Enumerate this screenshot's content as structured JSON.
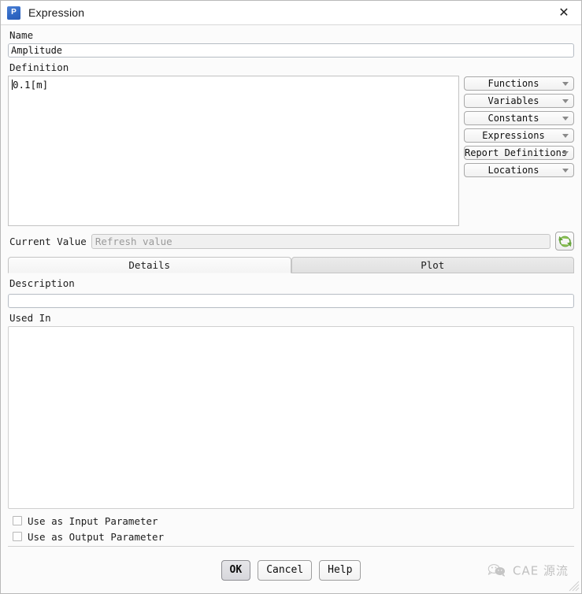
{
  "window": {
    "title": "Expression",
    "app_icon": "workbench-parameter-icon",
    "app_icon_glyph": "P",
    "close_label": "✕"
  },
  "form": {
    "name_label": "Name",
    "name_value": "Amplitude",
    "name_placeholder": "",
    "definition_label": "Definition",
    "definition_value": "0.1[m]",
    "current_value_label": "Current Value",
    "current_value_text": "",
    "current_value_placeholder": "Refresh value",
    "refresh_icon": "refresh-icon",
    "description_label": "Description",
    "description_value": "",
    "description_placeholder": "",
    "used_in_label": "Used In",
    "used_in_items": []
  },
  "dropdowns": [
    {
      "label": "Functions",
      "name": "functions"
    },
    {
      "label": "Variables",
      "name": "variables"
    },
    {
      "label": "Constants",
      "name": "constants"
    },
    {
      "label": "Expressions",
      "name": "expressions"
    },
    {
      "label": "Report Definitions",
      "name": "report-definitions"
    },
    {
      "label": "Locations",
      "name": "locations"
    }
  ],
  "tabs": [
    {
      "label": "Details",
      "selected": true
    },
    {
      "label": "Plot",
      "selected": false
    }
  ],
  "checkboxes": [
    {
      "label": "Use as Input Parameter",
      "checked": false
    },
    {
      "label": "Use as Output Parameter",
      "checked": false
    }
  ],
  "buttons": {
    "ok": "OK",
    "cancel": "Cancel",
    "help": "Help"
  },
  "watermark": {
    "text": "CAE 源流",
    "icon": "wechat-logo-icon"
  },
  "colors": {
    "accent_blue": "#2f67c4",
    "refresh_green": "#5f9f35",
    "window_bg": "#fbfbfb",
    "field_bg": "#ffffff",
    "disabled_bg": "#f0f0f0",
    "border": "#b6bcc4"
  }
}
